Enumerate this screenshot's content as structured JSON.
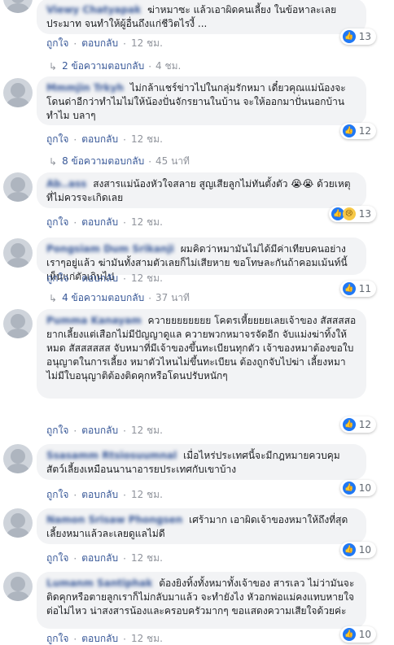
{
  "labels": {
    "like": "ถูกใจ",
    "reply": "ตอบกลับ",
    "sep": "·"
  },
  "comments": [
    {
      "author": "Viewy Chatyapak",
      "text": "ฆ่าหมาซะ แล้วเอาผิดคนเลี้ยง ในข้อหาละเลยประมาท จนทำให้ผู้อื่นถึงแก่ชีวิตไรงี้ ...",
      "reactions": "13",
      "time": "12 ชม.",
      "replies": {
        "label": "2 ข้อความตอบกลับ",
        "time": "4 ชม."
      }
    },
    {
      "author": "Mmmjin Trkyh",
      "text": "ไม่กล้าแชร์ข่าวไปในกลุ่มรักหมา เดี๋ยวคุณแม่น้องจะโดนด่าอีกว่าทำไมไม่ให้น้องปั่นจักรยานในบ้าน จะให้ออกมาปั่นนอกบ้านทำไม บลาๆ",
      "reactions": "12",
      "time": "12 ชม.",
      "replies": {
        "label": "8 ข้อความตอบกลับ",
        "time": "45 นาที"
      }
    },
    {
      "author": "Ab..ass",
      "text": "สงสารแม่น้องหัวใจสลาย สูญเสียลูกไม่ทันตั้งตัว 😭😭 ด้วยเหตุที่ไม่ควรจะเกิดเลย",
      "reactions": "13",
      "time": "12 ชม."
    },
    {
      "author": "Pongsiam Dum Srikanji",
      "text": "ผมคิดว่าหมามันไม่ได้มีค่าเทียบคนอย่างเราๆอยู่แล้ว ฆ่ามันทั้งสามตัวเลยก็ไม่เสียหาย ขอโทษละกันถ้าคอมเม้นท์นี้เห็นแก่ตัวเกินไป",
      "reactions": "11",
      "time": "12 ชม.",
      "replies": {
        "label": "4 ข้อความตอบกลับ",
        "time": "37 นาที"
      }
    },
    {
      "author": "Pumma Kanayam",
      "text": "ควายยยยยยยย โคตรเหี้ยยยยเลยเจ้าของ สัสสสสอยากเลี้ยงแต่เสือกไม่มีปัญญาดูแล ควายพวกหมาจรจัดอีก จับแม่งฆ่าทิ้งให้หมด สัสสสสสส จับหมาที่มีเจ้าของขึ้นทะเบียนทุกตัว เจ้าของหมาต้องขอใบอนุญาตในการเลี้ยง หมาตัวไหนไม่ขึ้นทะเบียน ต้องถูกจับไปฆ่า เลี้ยงหมาไม่มีใบอนุญาติต้องติดคุกหรือโดนปรับหนักๆ",
      "reactions": "12",
      "time": "12 ชม."
    },
    {
      "author": "Ssasamm Rtsiosuumnal",
      "text": "เมื่อไหร่ประเทศนี้จะมีกฎหมายควบคุมสัตว์เลี้ยงเหมือนนานาอารยประเทศกับเขาบ้าง",
      "reactions": "10",
      "time": "12 ชม."
    },
    {
      "author": "Namon Srisaw Phongsen",
      "text": "เศร้ามาก เอาผิดเจ้าของหมาให้ถึงที่สุด เลี้ยงหมาแล้วละเลยดูแลไม่ดี",
      "reactions": "10",
      "time": "12 ชม."
    },
    {
      "author": "Lumanm Santiphak",
      "text": "ต้องยิงทิ้งทั้งหมาทั้งเจ้าของ สารเลว ไม่ว่ามันจะติดคุกหรือตายลูกเราก็ไม่กลับมาแล้ว จะทำยังไง หัวอกพ่อแม่คงแทบหายใจต่อไม่ไหว น่าสงสารน้องและครอบครัวมากๆ ขอแสดงความเสียใจด้วยค่ะ",
      "reactions": "10",
      "time": "12 ชม."
    }
  ]
}
